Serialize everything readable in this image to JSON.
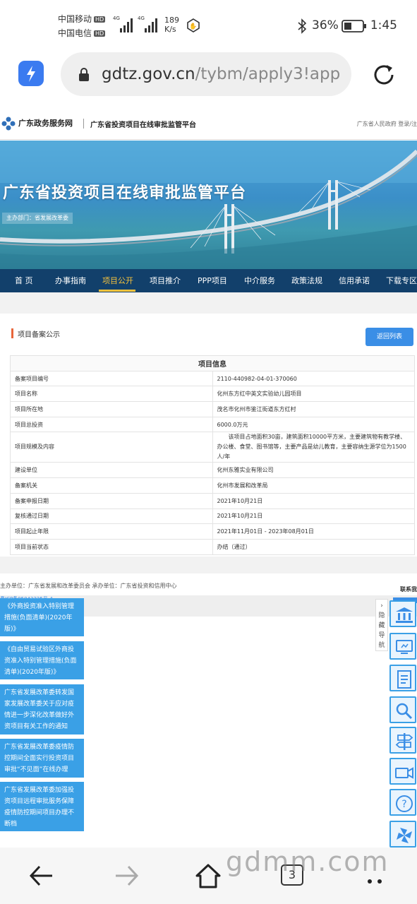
{
  "status_bar": {
    "carrier1": "中国移动",
    "carrier2": "中国电信",
    "hd": "HD",
    "net1": "4G",
    "net2": "4G",
    "speed_value": "189",
    "speed_unit": "K/s",
    "battery": "36%",
    "time": "1:45"
  },
  "browser": {
    "url_host": "gdtz.gov.cn",
    "url_path": "/tybm/apply3!app"
  },
  "site": {
    "name": "广东政务服务网",
    "platform": "广东省投资项目在线审批监管平台",
    "right_links": "广东省人民政府   登录/注"
  },
  "banner": {
    "title": "广东省投资项目在线审批监管平台",
    "subtitle": "主办部门：省发展改革委"
  },
  "nav": [
    "首 页",
    "办事指南",
    "项目公开",
    "项目推介",
    "PPP项目",
    "中介服务",
    "政策法规",
    "信用承诺",
    "下载专区"
  ],
  "content": {
    "section_title": "项目备案公示",
    "back_button": "返回列表",
    "table_title": "项目信息",
    "rows": [
      {
        "label": "备案项目编号",
        "value": "2110-440982-04-01-370060"
      },
      {
        "label": "项目名称",
        "value": "化州东方红中英文实验幼儿园项目"
      },
      {
        "label": "项目所在地",
        "value": "茂名市化州市鉴江街道东方红村"
      },
      {
        "label": "项目总投资",
        "value": "6000.0万元"
      },
      {
        "label": "项目规模及内容",
        "value": "该项目占地面积30亩，建筑面积10000平方米，主要建筑物有教学楼、办公楼、食堂、图书馆等，主要产品是幼儿教育，主要容纳生源学位为1500人/年"
      },
      {
        "label": "建设单位",
        "value": "化州东雅实业有限公司"
      },
      {
        "label": "备案机关",
        "value": "化州市发展和改革局"
      },
      {
        "label": "备案申报日期",
        "value": "2021年10月21日"
      },
      {
        "label": "复核通过日期",
        "value": "2021年10月21日"
      },
      {
        "label": "项目起止年限",
        "value": "2021年11月01日 - 2023年08月01日"
      },
      {
        "label": "项目当前状态",
        "value": "办结（通过）"
      }
    ]
  },
  "footer": {
    "sponsor": "主办单位：广东省发展和改革委员会    承办单位：广东省投资和信用中心",
    "contact": "联系我",
    "icp": "粤ICP备05042325号-4"
  },
  "notices": [
    "《外商投资准入特别管理措施(负面清单)(2020年版)》",
    "《自由贸易试验区外商投资准入特别管理措施(负面清单)(2020年版)》",
    "广东省发展改革委转发国家发展改革委关于应对疫情进一步深化改革做好外资项目有关工作的通知",
    "广东省发展改革委疫情防控期间全面实行投资项目审批“不见面”在线办理",
    "广东省发展改革委加强投资项目远程审批服务保障疫情防控期间项目办理不断档"
  ],
  "side_toggle": "隐藏导航",
  "bottom": {
    "tab_count": "3",
    "watermark": "gdmm.com"
  }
}
